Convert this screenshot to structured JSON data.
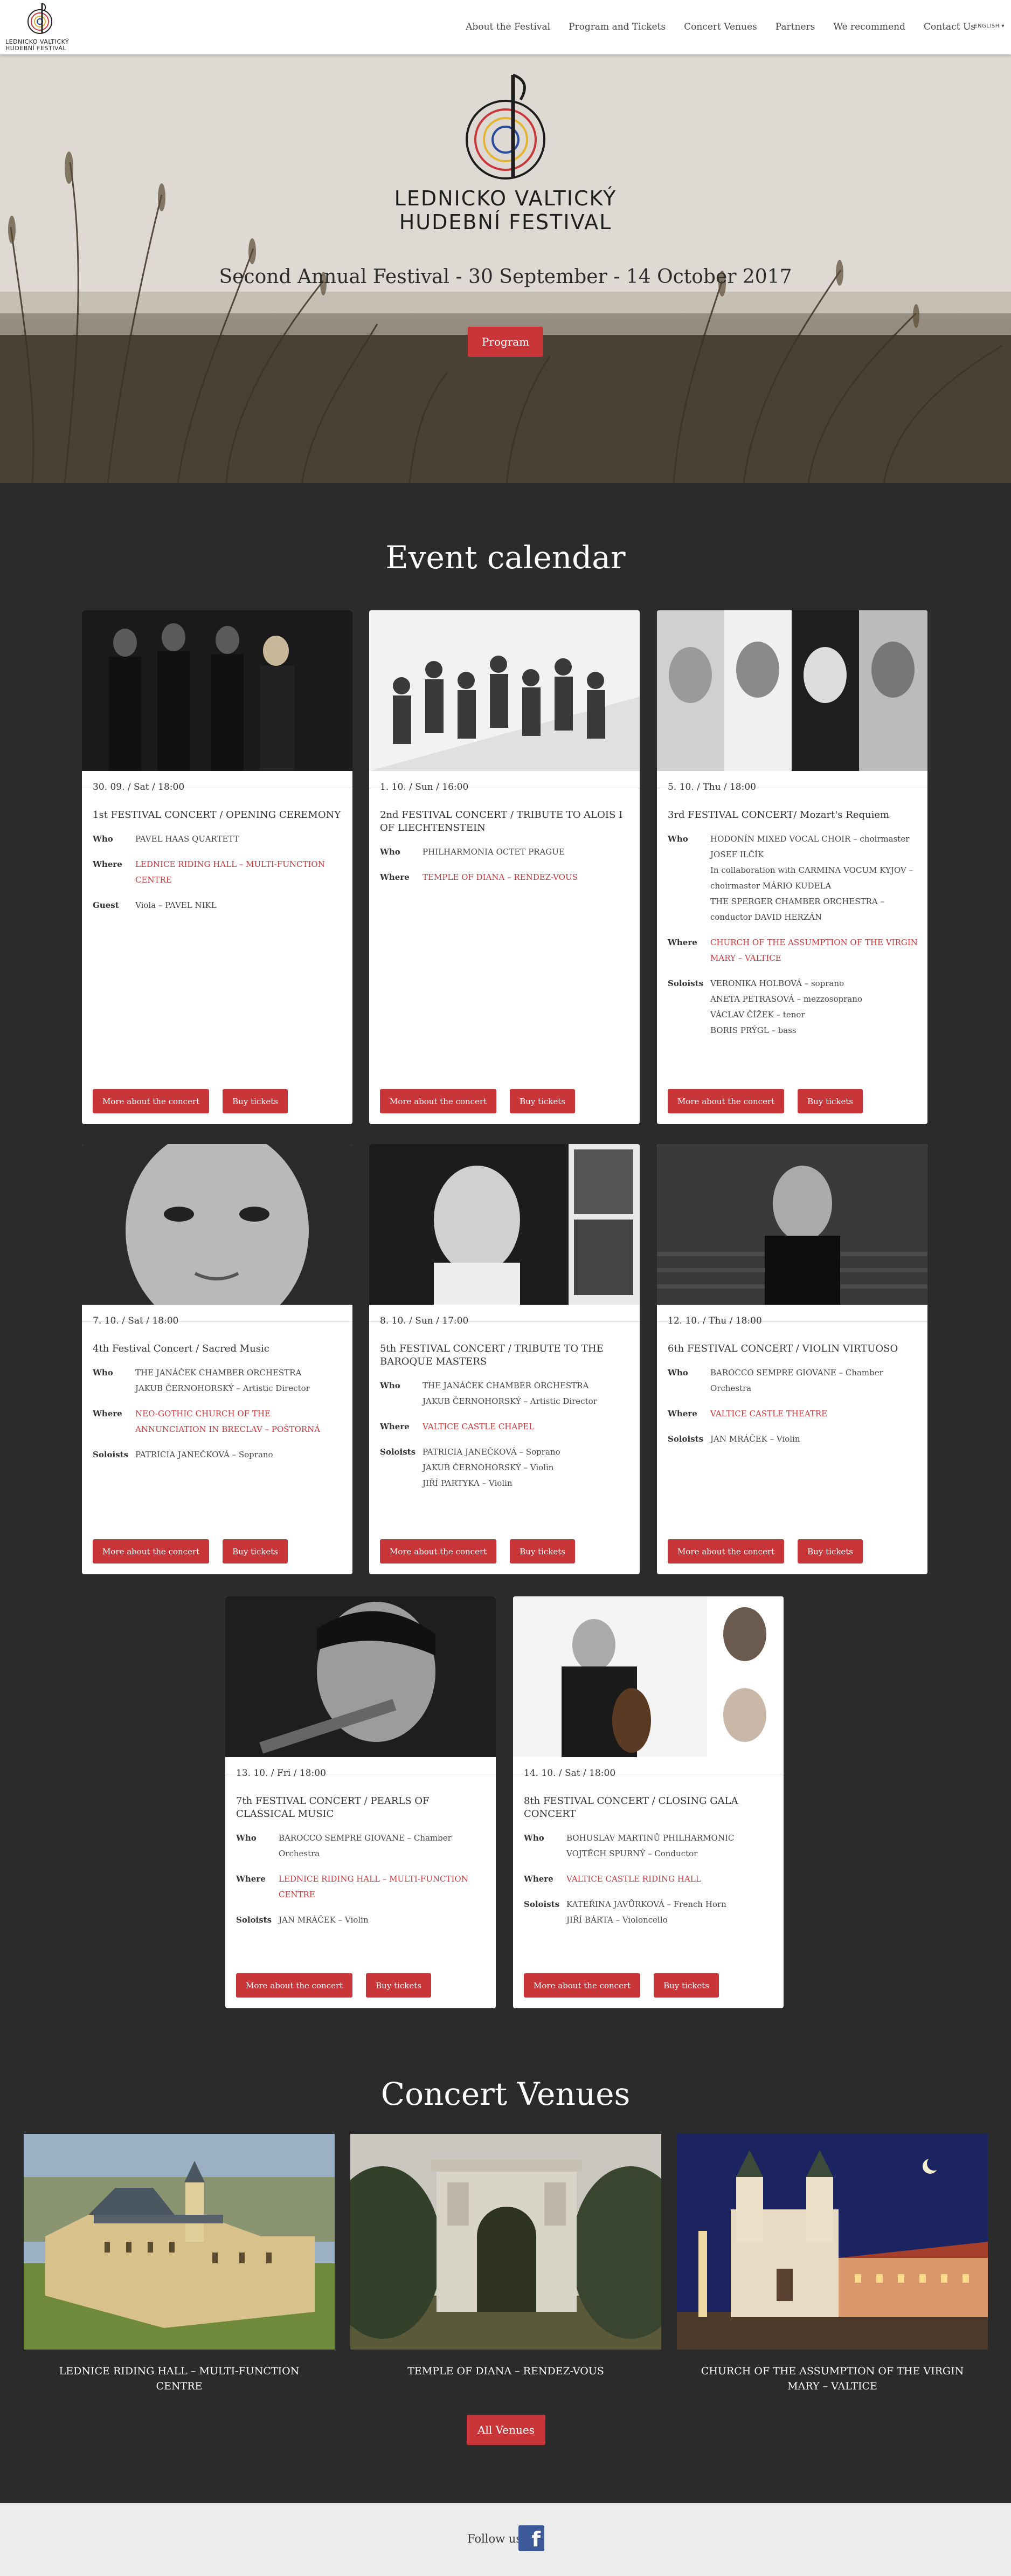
{
  "nav": {
    "logo_text_1": "LEDNICKO VALTICKÝ",
    "logo_text_2": "HUDEBNÍ FESTIVAL",
    "links": [
      "About the Festival",
      "Program and Tickets",
      "Concert Venues",
      "Partners",
      "We recommend",
      "Contact Us"
    ],
    "language": "ENGLISH ▾"
  },
  "hero": {
    "logo_line_1": "LEDNICKO VALTICKÝ",
    "logo_line_2": "HUDEBNÍ FESTIVAL",
    "subtitle": "Second Annual Festival - 30 September - 14 October 2017",
    "button": "Program"
  },
  "calendar": {
    "title": "Event calendar",
    "labels": {
      "who": "Who",
      "where": "Where",
      "guest": "Guest",
      "soloists": "Soloists"
    },
    "more_button": "More about the concert",
    "tickets_button": "Buy tickets",
    "events": [
      {
        "date": "30. 09. / Sat / 18:00",
        "title": "1st FESTIVAL CONCERT / OPENING CEREMONY",
        "who": "PAVEL HAAS QUARTETT",
        "where": "LEDNICE RIDING HALL – MULTI-FUNCTION CENTRE",
        "extra_label": "Guest",
        "extra": "Viola – PAVEL NIKL"
      },
      {
        "date": "1. 10. / Sun / 16:00",
        "title": "2nd FESTIVAL CONCERT / TRIBUTE TO ALOIS I OF LIECHTENSTEIN",
        "who": "PHILHARMONIA OCTET PRAGUE",
        "where": "TEMPLE OF DIANA – RENDEZ-VOUS",
        "extra_label": "",
        "extra": ""
      },
      {
        "date": "5. 10. / Thu / 18:00",
        "title": "3rd FESTIVAL CONCERT/ Mozart's Requiem",
        "who": "HODONÍN MIXED VOCAL CHOIR – choirmaster JOSEF ILČÍK\nIn collaboration with CARMINA VOCUM KYJOV – choirmaster MÁRIO KUDELA\nTHE SPERGER CHAMBER ORCHESTRA – conductor DAVID HERZÁN",
        "where": "CHURCH OF THE ASSUMPTION OF THE VIRGIN MARY – VALTICE",
        "extra_label": "Soloists",
        "extra": "VERONIKA HOLBOVÁ – soprano\nANETA PETRASOVÁ – mezzosoprano\nVÁCLAV ČÍŽEK – tenor\nBORIS PRÝGL – bass"
      },
      {
        "date": "7. 10. / Sat / 18:00",
        "title": "4th Festival Concert / Sacred Music",
        "who": "THE JANÁČEK CHAMBER ORCHESTRA\nJAKUB ČERNOHORSKÝ – Artistic Director",
        "where": "NEO-GOTHIC CHURCH OF THE ANNUNCIATION IN BRECLAV – POŠTORNÁ",
        "extra_label": "Soloists",
        "extra": "PATRICIA JANEČKOVÁ – Soprano"
      },
      {
        "date": "8. 10. / Sun / 17:00",
        "title": "5th FESTIVAL CONCERT / TRIBUTE TO THE BAROQUE MASTERS",
        "who": "THE JANÁČEK CHAMBER ORCHESTRA\nJAKUB ČERNOHORSKÝ – Artistic Director",
        "where": "VALTICE CASTLE CHAPEL",
        "extra_label": "Soloists",
        "extra": "PATRICIA JANEČKOVÁ – Soprano\nJAKUB ČERNOHORSKÝ – Violin\nJIŘÍ PARTYKA – Violin"
      },
      {
        "date": "12. 10. / Thu / 18:00",
        "title": "6th FESTIVAL CONCERT / VIOLIN VIRTUOSO",
        "who": "BAROCCO SEMPRE GIOVANE – Chamber Orchestra",
        "where": "VALTICE CASTLE THEATRE",
        "extra_label": "Soloists",
        "extra": "JAN MRÁČEK – Violin"
      },
      {
        "date": "13. 10. / Fri / 18:00",
        "title": "7th FESTIVAL CONCERT / PEARLS OF CLASSICAL MUSIC",
        "who": "BAROCCO SEMPRE GIOVANE – Chamber Orchestra",
        "where": "LEDNICE RIDING HALL – MULTI-FUNCTION CENTRE",
        "extra_label": "Soloists",
        "extra": "JAN MRÁČEK – Violin"
      },
      {
        "date": "14. 10. / Sat / 18:00",
        "title": "8th FESTIVAL CONCERT / CLOSING GALA CONCERT",
        "who": "BOHUSLAV MARTINŮ PHILHARMONIC\nVOJTĚCH SPURNÝ – Conductor",
        "where": "VALTICE CASTLE RIDING HALL",
        "extra_label": "Soloists",
        "extra": "KATEŘINA JAVŮRKOVÁ – French Horn\nJIŘÍ BÁRTA – Violoncello"
      }
    ]
  },
  "venues": {
    "title": "Concert Venues",
    "items": [
      "LEDNICE RIDING HALL – MULTI-FUNCTION CENTRE",
      "TEMPLE OF DIANA – RENDEZ-VOUS",
      "CHURCH OF THE ASSUMPTION OF THE VIRGIN MARY – VALTICE"
    ],
    "button": "All Venues"
  },
  "footer": {
    "follow": "Follow us",
    "facebook_icon": "facebook-icon"
  },
  "colors": {
    "accent": "#c8363a",
    "dark_bg": "#2b2b2b",
    "footer_bg": "#ececec"
  }
}
